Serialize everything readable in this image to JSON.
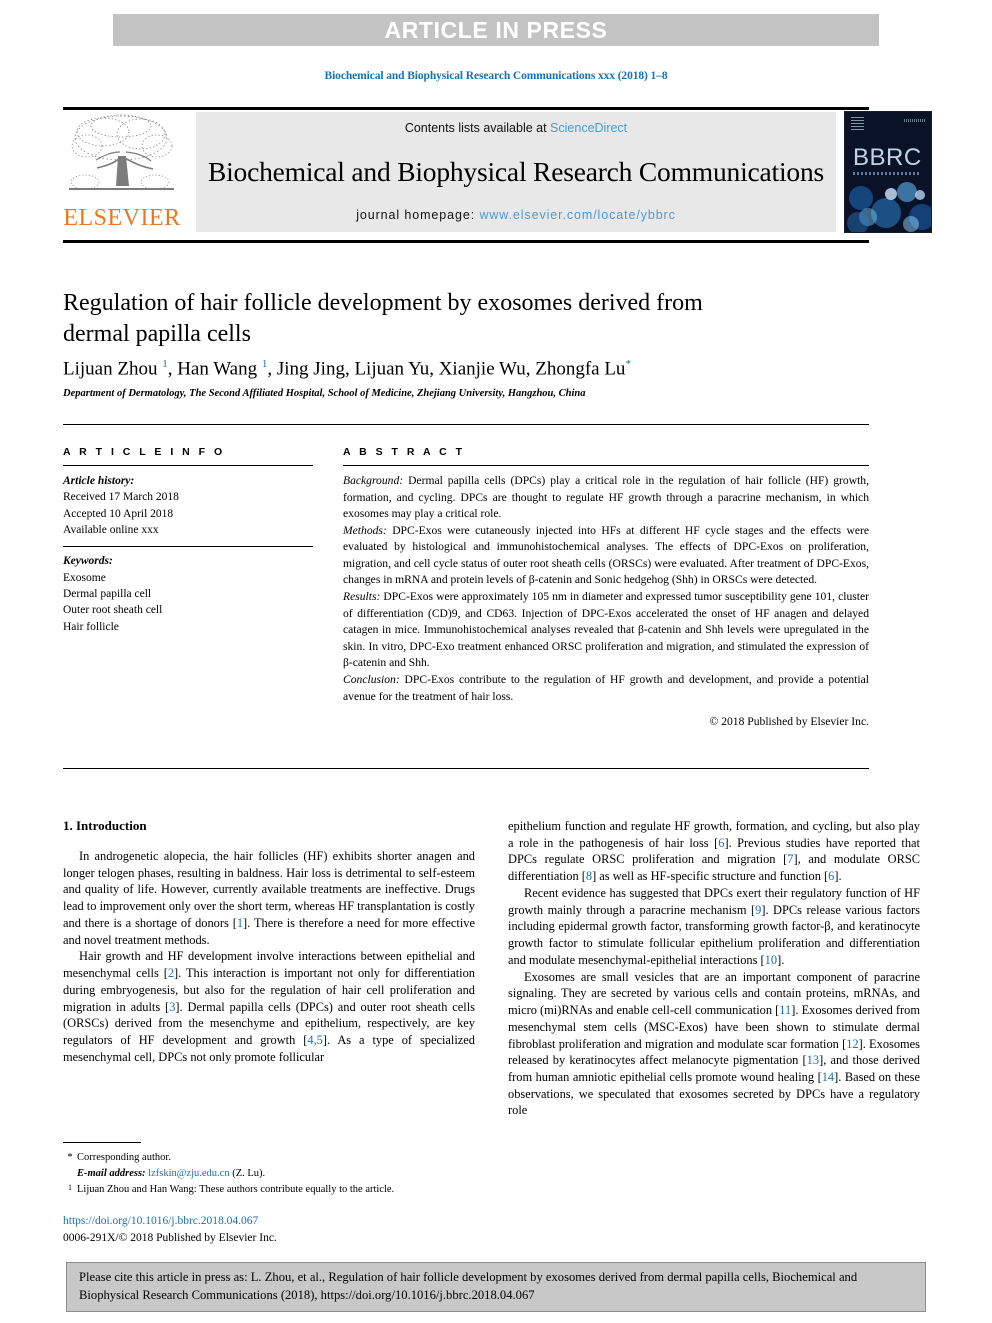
{
  "banner": {
    "text": "ARTICLE IN PRESS"
  },
  "running_head": "Biochemical and Biophysical Research Communications xxx (2018) 1–8",
  "masthead": {
    "contents_prefix": "Contents lists available at ",
    "sciencedirect": "ScienceDirect",
    "journal_name": "Biochemical and Biophysical Research Communications",
    "homepage_prefix": "journal homepage: ",
    "homepage_url": "www.elsevier.com/locate/ybbrc",
    "elsevier_wordmark": "ELSEVIER",
    "cover_title": "BBRC",
    "accent_link": "#4b9ad4",
    "elsevier_orange": "#e87722",
    "cover_background": "#0a1228"
  },
  "article": {
    "title": "Regulation of hair follicle development by exosomes derived from dermal papilla cells",
    "authors_html": "Lijuan Zhou <sup>1</sup>, Han Wang <sup>1</sup>, Jing Jing, Lijuan Yu, Xianjie Wu, Zhongfa Lu<sup>*</sup>",
    "affiliation": "Department of Dermatology, The Second Affiliated Hospital, School of Medicine, Zhejiang University, Hangzhou, China"
  },
  "article_info": {
    "heading": "A R T I C L E   I N F O",
    "history_label": "Article history:",
    "history": [
      "Received 17 March 2018",
      "Accepted 10 April 2018",
      "Available online xxx"
    ],
    "keywords_label": "Keywords:",
    "keywords": [
      "Exosome",
      "Dermal papilla cell",
      "Outer root sheath cell",
      "Hair follicle"
    ]
  },
  "abstract": {
    "heading": "A B S T R A C T",
    "background_label": "Background:",
    "background": "Dermal papilla cells (DPCs) play a critical role in the regulation of hair follicle (HF) growth, formation, and cycling. DPCs are thought to regulate HF growth through a paracrine mechanism, in which exosomes may play a critical role.",
    "methods_label": "Methods:",
    "methods": "DPC-Exos were cutaneously injected into HFs at different HF cycle stages and the effects were evaluated by histological and immunohistochemical analyses. The effects of DPC-Exos on proliferation, migration, and cell cycle status of outer root sheath cells (ORSCs) were evaluated. After treatment of DPC-Exos, changes in mRNA and protein levels of β-catenin and Sonic hedgehog (Shh) in ORSCs were detected.",
    "results_label": "Results:",
    "results": "DPC-Exos were approximately 105 nm in diameter and expressed tumor susceptibility gene 101, cluster of differentiation (CD)9, and CD63. Injection of DPC-Exos accelerated the onset of HF anagen and delayed catagen in mice. Immunohistochemical analyses revealed that β-catenin and Shh levels were upregulated in the skin. In vitro, DPC-Exo treatment enhanced ORSC proliferation and migration, and stimulated the expression of β-catenin and Shh.",
    "conclusion_label": "Conclusion:",
    "conclusion": "DPC-Exos contribute to the regulation of HF growth and development, and provide a potential avenue for the treatment of hair loss.",
    "copyright": "© 2018 Published by Elsevier Inc."
  },
  "body": {
    "section_heading": "1. Introduction",
    "left_paragraphs": [
      "In androgenetic alopecia, the hair follicles (HF) exhibits shorter anagen and longer telogen phases, resulting in baldness. Hair loss is detrimental to self-esteem and quality of life. However, currently available treatments are ineffective. Drugs lead to improvement only over the short term, whereas HF transplantation is costly and there is a shortage of donors [1]. There is therefore a need for more effective and novel treatment methods.",
      "Hair growth and HF development involve interactions between epithelial and mesenchymal cells [2]. This interaction is important not only for differentiation during embryogenesis, but also for the regulation of hair cell proliferation and migration in adults [3]. Dermal papilla cells (DPCs) and outer root sheath cells (ORSCs) derived from the mesenchyme and epithelium, respectively, are key regulators of HF development and growth [4,5]. As a type of specialized mesenchymal cell, DPCs not only promote follicular"
    ],
    "right_paragraphs": [
      "epithelium function and regulate HF growth, formation, and cycling, but also play a role in the pathogenesis of hair loss [6]. Previous studies have reported that DPCs regulate ORSC proliferation and migration [7], and modulate ORSC differentiation [8] as well as HF-specific structure and function [6].",
      "Recent evidence has suggested that DPCs exert their regulatory function of HF growth mainly through a paracrine mechanism [9]. DPCs release various factors including epidermal growth factor, transforming growth factor-β, and keratinocyte growth factor to stimulate follicular epithelium proliferation and differentiation and modulate mesenchymal-epithelial interactions [10].",
      "Exosomes are small vesicles that are an important component of paracrine signaling. They are secreted by various cells and contain proteins, mRNAs, and micro (mi)RNAs and enable cell-cell communication [11]. Exosomes derived from mesenchymal stem cells (MSC-Exos) have been shown to stimulate dermal fibroblast proliferation and migration and modulate scar formation [12]. Exosomes released by keratinocytes affect melanocyte pigmentation [13], and those derived from human amniotic epithelial cells promote wound healing [14]. Based on these observations, we speculated that exosomes secreted by DPCs have a regulatory role"
    ]
  },
  "footnotes": {
    "corresponding_mark": "*",
    "corresponding_text": "Corresponding author.",
    "email_label": "E-mail address:",
    "email": "lzfskin@zju.edu.cn",
    "email_suffix": "(Z. Lu).",
    "equal_mark": "1",
    "equal_text": "Lijuan Zhou and Han Wang: These authors contribute equally to the article.",
    "doi": "https://doi.org/10.1016/j.bbrc.2018.04.067",
    "issn_line": "0006-291X/© 2018 Published by Elsevier Inc."
  },
  "citation_box": {
    "text": "Please cite this article in press as: L. Zhou, et al., Regulation of hair follicle development by exosomes derived from dermal papilla cells, Biochemical and Biophysical Research Communications (2018), https://doi.org/10.1016/j.bbrc.2018.04.067"
  }
}
